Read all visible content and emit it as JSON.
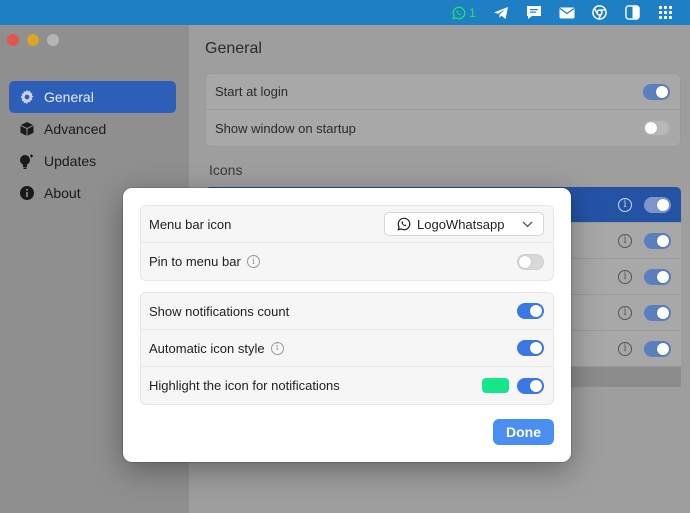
{
  "menubar": {
    "whatsapp_count": "1",
    "items": [
      "whatsapp-icon",
      "telegram-icon",
      "messages-icon",
      "mail-icon",
      "chrome-icon",
      "split-view-icon",
      "grid-icon"
    ]
  },
  "sidebar": {
    "items": [
      {
        "label": "General",
        "icon": "gear-icon",
        "active": true
      },
      {
        "label": "Advanced",
        "icon": "cube-icon",
        "active": false
      },
      {
        "label": "Updates",
        "icon": "lightbulb-icon",
        "active": false
      },
      {
        "label": "About",
        "icon": "info-icon",
        "active": false
      }
    ]
  },
  "main": {
    "title": "General",
    "rows": [
      {
        "label": "Start at login",
        "on": true
      },
      {
        "label": "Show window on startup",
        "on": false
      }
    ],
    "icons_label": "Icons"
  },
  "dialog": {
    "menu_bar_icon_label": "Menu bar icon",
    "menu_bar_icon_value": "LogoWhatsapp",
    "pin_label": "Pin to menu bar",
    "pin_on": false,
    "show_count_label": "Show notifications count",
    "show_count_on": true,
    "auto_style_label": "Automatic icon style",
    "auto_style_on": true,
    "highlight_label": "Highlight the icon for notifications",
    "highlight_on": true,
    "highlight_color": "#16e68a",
    "done_label": "Done"
  },
  "colors": {
    "accent": "#3a78e6",
    "sidebar_active": "#2e5fb8",
    "menubar": "#1f7fc4"
  }
}
